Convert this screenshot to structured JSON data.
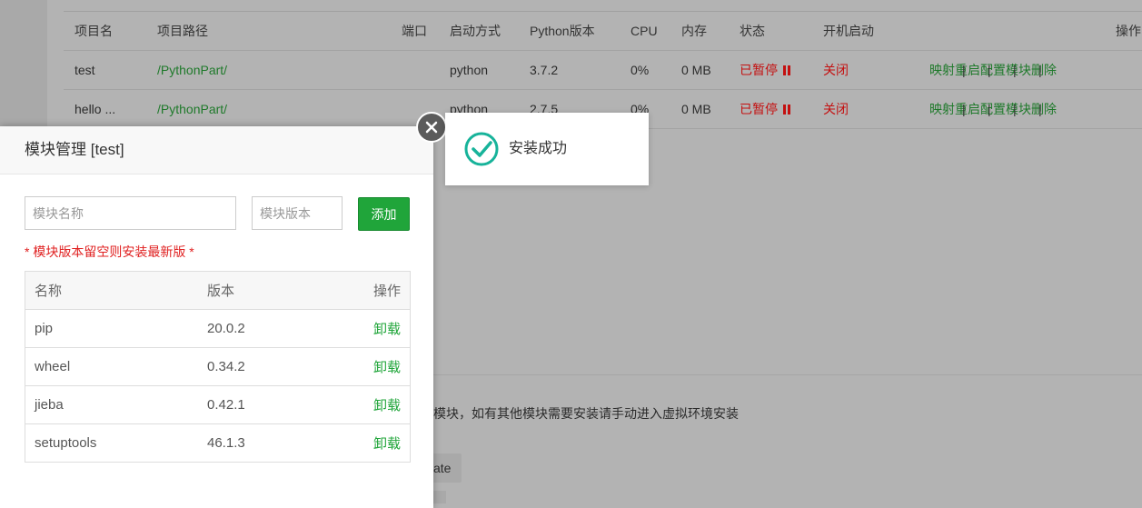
{
  "project_table": {
    "headers": [
      "项目名",
      "项目路径",
      "端口",
      "启动方式",
      "Python版本",
      "CPU",
      "内存",
      "状态",
      "开机启动",
      "操作"
    ],
    "rows": [
      {
        "name": "test",
        "path": "/PythonPart/",
        "port": "",
        "start": "python",
        "version": "3.7.2",
        "cpu": "0%",
        "mem": "0 MB",
        "status": "已暂停",
        "boot": "关闭"
      },
      {
        "name": "hello ...",
        "path": "/PythonPart/",
        "port": "",
        "start": "python",
        "version": "2.7.5",
        "cpu": "0%",
        "mem": "0 MB",
        "status": "已暂停",
        "boot": "关闭"
      }
    ],
    "ops": [
      "映射",
      "重启",
      "配置",
      "模块",
      "删除"
    ]
  },
  "modal": {
    "title": "模块管理 [test]",
    "name_placeholder": "模块名称",
    "version_placeholder": "模块版本",
    "add_label": "添加",
    "hint": "* 模块版本留空则安装最新版 *",
    "table": {
      "headers": [
        "名称",
        "版本",
        "操作"
      ],
      "rows": [
        {
          "name": "pip",
          "version": "20.0.2",
          "op": "卸载"
        },
        {
          "name": "wheel",
          "version": "0.34.2",
          "op": "卸载"
        },
        {
          "name": "jieba",
          "version": "0.42.1",
          "op": "卸载"
        },
        {
          "name": "setuptools",
          "version": "46.1.3",
          "op": "卸载"
        }
      ]
    }
  },
  "toast": {
    "message": "安装成功",
    "icon": "check-circle-icon"
  },
  "background_text": {
    "note": "模块，如有其他模块需要安装请手动进入虚拟环境安装",
    "button_fragment": "ate"
  },
  "colors": {
    "accent_green": "#20a53a",
    "link_green": "#1f7a2b",
    "status_red": "#c41010"
  }
}
